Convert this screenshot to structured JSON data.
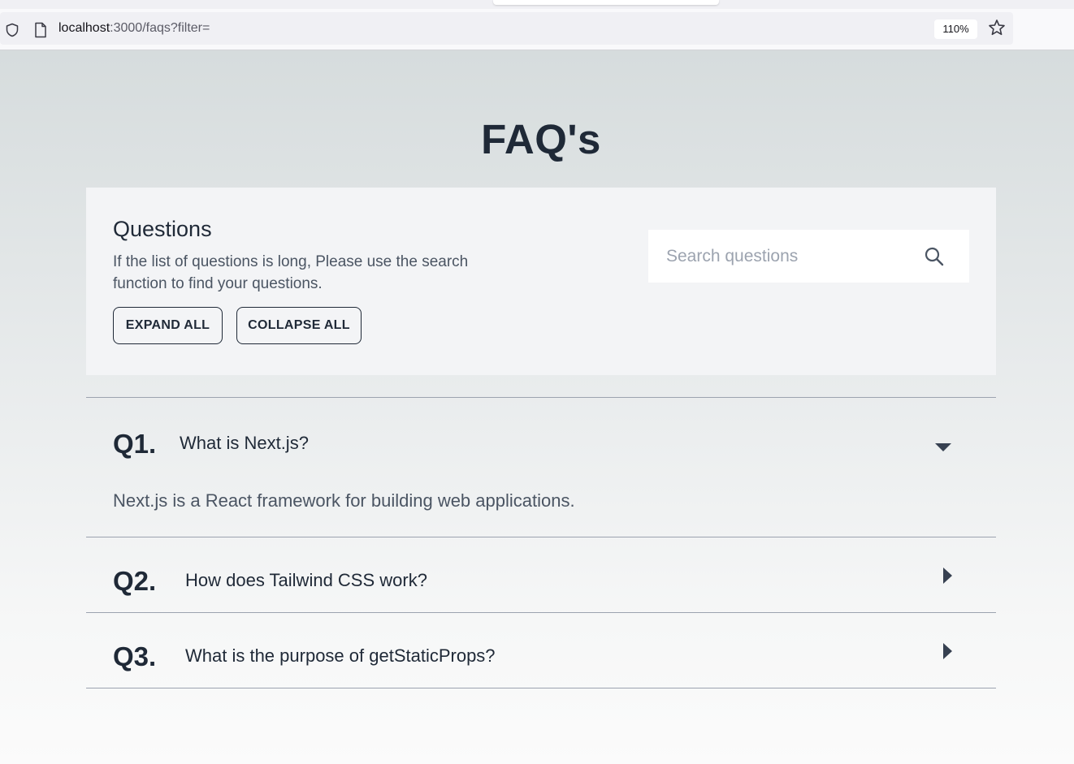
{
  "browser": {
    "url_host": "localhost",
    "url_rest": ":3000/faqs?filter=",
    "zoom": "110%"
  },
  "page": {
    "title": "FAQ's"
  },
  "panel": {
    "heading": "Questions",
    "description": "If the list of questions is long, Please use the search function to find your questions.",
    "expand_all_label": "EXPAND ALL",
    "collapse_all_label": "COLLAPSE ALL",
    "search_placeholder": "Search questions",
    "search_value": ""
  },
  "faqs": [
    {
      "number": "Q1.",
      "question": "What is Next.js?",
      "answer": "Next.js is a React framework for building web applications.",
      "expanded": true
    },
    {
      "number": "Q2.",
      "question": "How does Tailwind CSS work?",
      "expanded": false
    },
    {
      "number": "Q3.",
      "question": "What is the purpose of getStaticProps?",
      "expanded": false
    }
  ],
  "colors": {
    "text_primary": "#1f2937",
    "text_secondary": "#4b5563",
    "panel_bg": "#f3f4f6",
    "divider": "#9ca3af"
  }
}
